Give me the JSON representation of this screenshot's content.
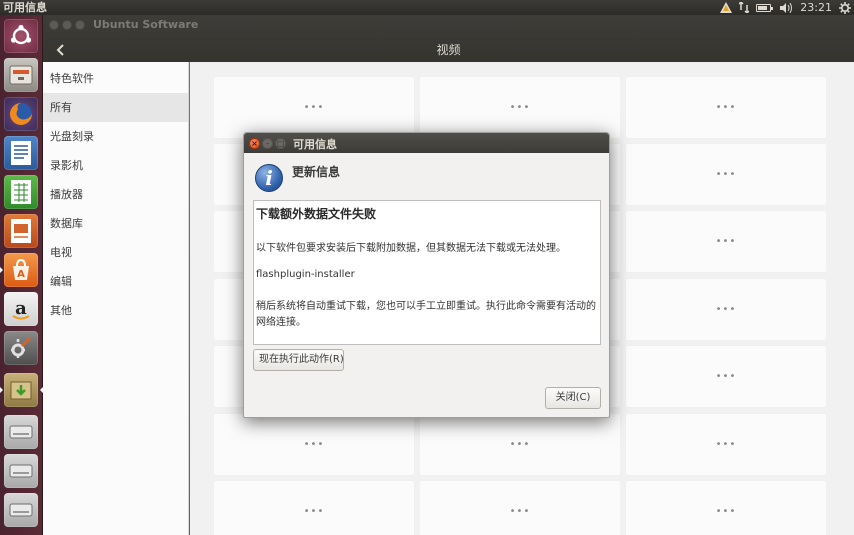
{
  "top_panel": {
    "app_title": "可用信息",
    "clock": "23:21",
    "indicators": [
      "updates-icon",
      "network-icon",
      "battery-icon",
      "volume-icon",
      "gear-icon"
    ]
  },
  "launcher": {
    "items": [
      "ubuntu-dash",
      "files",
      "firefox",
      "libreoffice-writer",
      "libreoffice-calc",
      "libreoffice-impress",
      "ubuntu-software",
      "amazon",
      "system-settings",
      "software-updater",
      "drive-1",
      "drive-2",
      "drive-3"
    ]
  },
  "software_window": {
    "app_name": "Ubuntu Software",
    "page_title": "视频",
    "back_icon": "‹",
    "categories": [
      {
        "label": "特色软件",
        "active": false
      },
      {
        "label": "所有",
        "active": true
      },
      {
        "label": "光盘刻录",
        "active": false
      },
      {
        "label": "录影机",
        "active": false
      },
      {
        "label": "播放器",
        "active": false
      },
      {
        "label": "数据库",
        "active": false
      },
      {
        "label": "电视",
        "active": false
      },
      {
        "label": "编辑",
        "active": false
      },
      {
        "label": "其他",
        "active": false
      }
    ],
    "tile_placeholder": "•••"
  },
  "dialog": {
    "title": "可用信息",
    "heading": "更新信息",
    "headline": "下载额外数据文件失败",
    "line1": "以下软件包要求安装后下载附加数据，但其数据无法下载或无法处理。",
    "package": "flashplugin-installer",
    "line2": "稍后系统将自动重试下载，您也可以手工立即重试。执行此命令需要有活动的网络连接。",
    "run_button": "现在执行此动作(R)",
    "close_button": "关闭(C)"
  },
  "colors": {
    "accent_orange": "#dd4814",
    "panel_dark": "#3c3b37",
    "launcher_bg": "#4a2330"
  }
}
